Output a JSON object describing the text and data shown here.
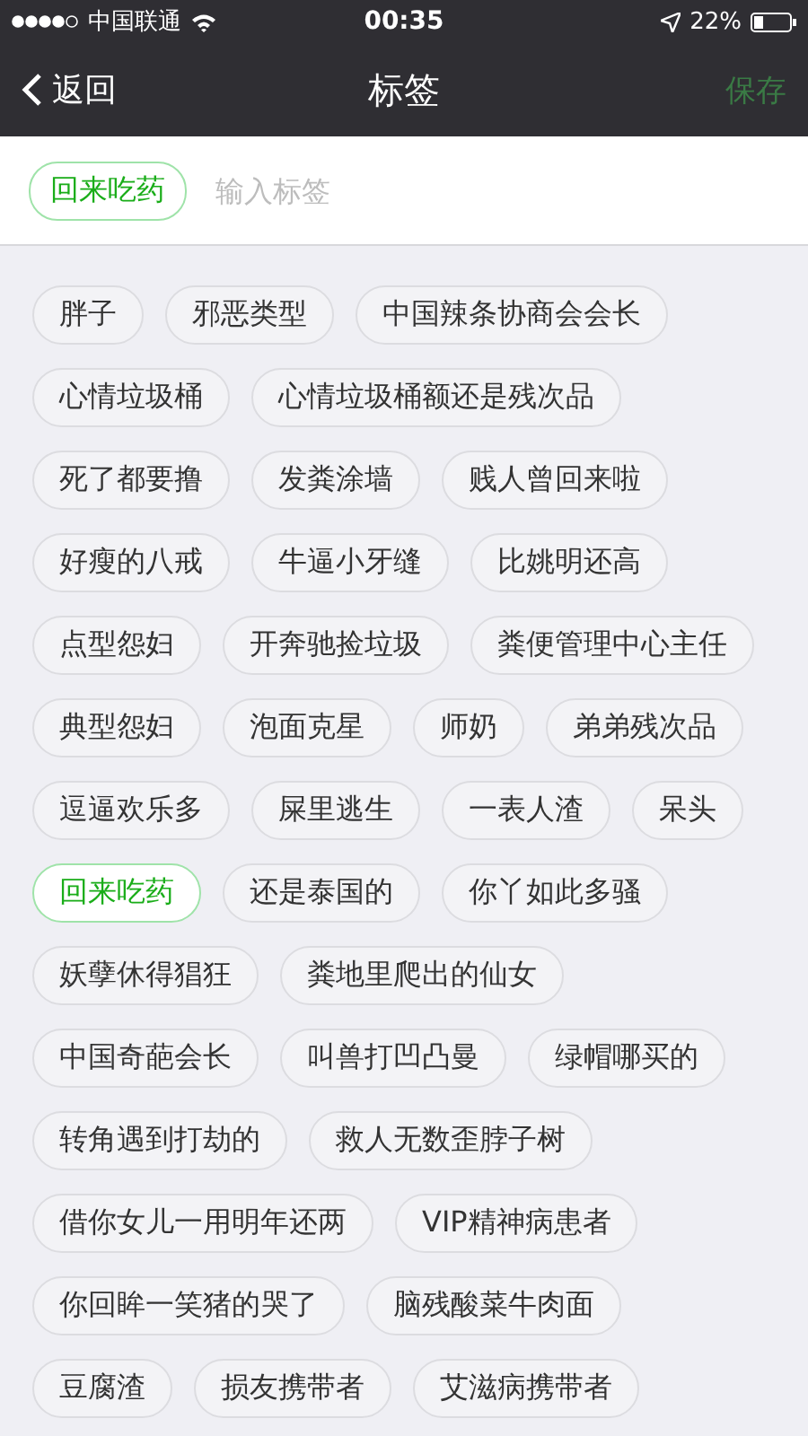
{
  "status_bar": {
    "carrier": "中国联通",
    "time": "00:35",
    "battery": "22%"
  },
  "nav": {
    "back": "返回",
    "title": "标签",
    "save": {
      "label": "保存",
      "disabled": true
    }
  },
  "input": {
    "chips": [
      "回来吃药"
    ],
    "placeholder": "输入标签"
  },
  "tags": [
    {
      "label": "胖子",
      "selected": false
    },
    {
      "label": "邪恶类型",
      "selected": false
    },
    {
      "label": "中国辣条协商会会长",
      "selected": false
    },
    {
      "label": "心情垃圾桶",
      "selected": false
    },
    {
      "label": "心情垃圾桶额还是残次品",
      "selected": false
    },
    {
      "label": "死了都要撸",
      "selected": false
    },
    {
      "label": "发粪涂墙",
      "selected": false
    },
    {
      "label": "贱人曾回来啦",
      "selected": false
    },
    {
      "label": "好瘦的八戒",
      "selected": false
    },
    {
      "label": "牛逼小牙缝",
      "selected": false
    },
    {
      "label": "比姚明还高",
      "selected": false
    },
    {
      "label": "点型怨妇",
      "selected": false
    },
    {
      "label": "开奔驰捡垃圾",
      "selected": false
    },
    {
      "label": "粪便管理中心主任",
      "selected": false
    },
    {
      "label": "典型怨妇",
      "selected": false
    },
    {
      "label": "泡面克星",
      "selected": false
    },
    {
      "label": "师奶",
      "selected": false
    },
    {
      "label": "弟弟残次品",
      "selected": false
    },
    {
      "label": "逗逼欢乐多",
      "selected": false
    },
    {
      "label": "屎里逃生",
      "selected": false
    },
    {
      "label": "一表人渣",
      "selected": false
    },
    {
      "label": "呆头",
      "selected": false
    },
    {
      "label": "回来吃药",
      "selected": true
    },
    {
      "label": "还是泰国的",
      "selected": false
    },
    {
      "label": "你丫如此多骚",
      "selected": false
    },
    {
      "label": "妖孽休得猖狂",
      "selected": false
    },
    {
      "label": "粪地里爬出的仙女",
      "selected": false
    },
    {
      "label": "中国奇葩会长",
      "selected": false
    },
    {
      "label": "叫兽打凹凸曼",
      "selected": false
    },
    {
      "label": "绿帽哪买的",
      "selected": false
    },
    {
      "label": "转角遇到打劫的",
      "selected": false
    },
    {
      "label": "救人无数歪脖子树",
      "selected": false
    },
    {
      "label": "借你女儿一用明年还两",
      "selected": false
    },
    {
      "label": "VIP精神病患者",
      "selected": false
    },
    {
      "label": "你回眸一笑猪的哭了",
      "selected": false
    },
    {
      "label": "脑残酸菜牛肉面",
      "selected": false
    },
    {
      "label": "豆腐渣",
      "selected": false
    },
    {
      "label": "损友携带者",
      "selected": false
    },
    {
      "label": "艾滋病携带者",
      "selected": false
    }
  ]
}
